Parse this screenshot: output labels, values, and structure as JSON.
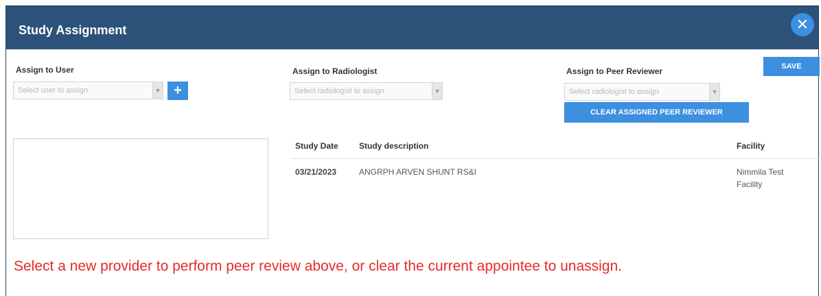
{
  "dialog": {
    "title": "Study Assignment",
    "close_icon": "close-icon",
    "save_label": "SAVE"
  },
  "assign_user": {
    "label": "Assign to User",
    "placeholder": "Select user to assign",
    "add_label": "+"
  },
  "assign_radiologist": {
    "label": "Assign to Radiologist",
    "placeholder": "Select radiologist to assign"
  },
  "assign_peer": {
    "label": "Assign to Peer Reviewer",
    "placeholder": "Select radiologist to assign",
    "clear_label": "CLEAR ASSIGNED PEER REVIEWER"
  },
  "table": {
    "headers": [
      "Study Date",
      "Study description",
      "Facility"
    ],
    "rows": [
      {
        "date": "03/21/2023",
        "description": "ANGRPH ARVEN SHUNT RS&I",
        "facility_line1": "Nimmila Test",
        "facility_line2": "Facility"
      }
    ]
  },
  "message": "Select a new provider to perform peer review above, or clear the current appointee to unassign.",
  "colors": {
    "header_bg": "#2d5279",
    "accent": "#3d8fe0",
    "warning": "#e62a2a"
  }
}
